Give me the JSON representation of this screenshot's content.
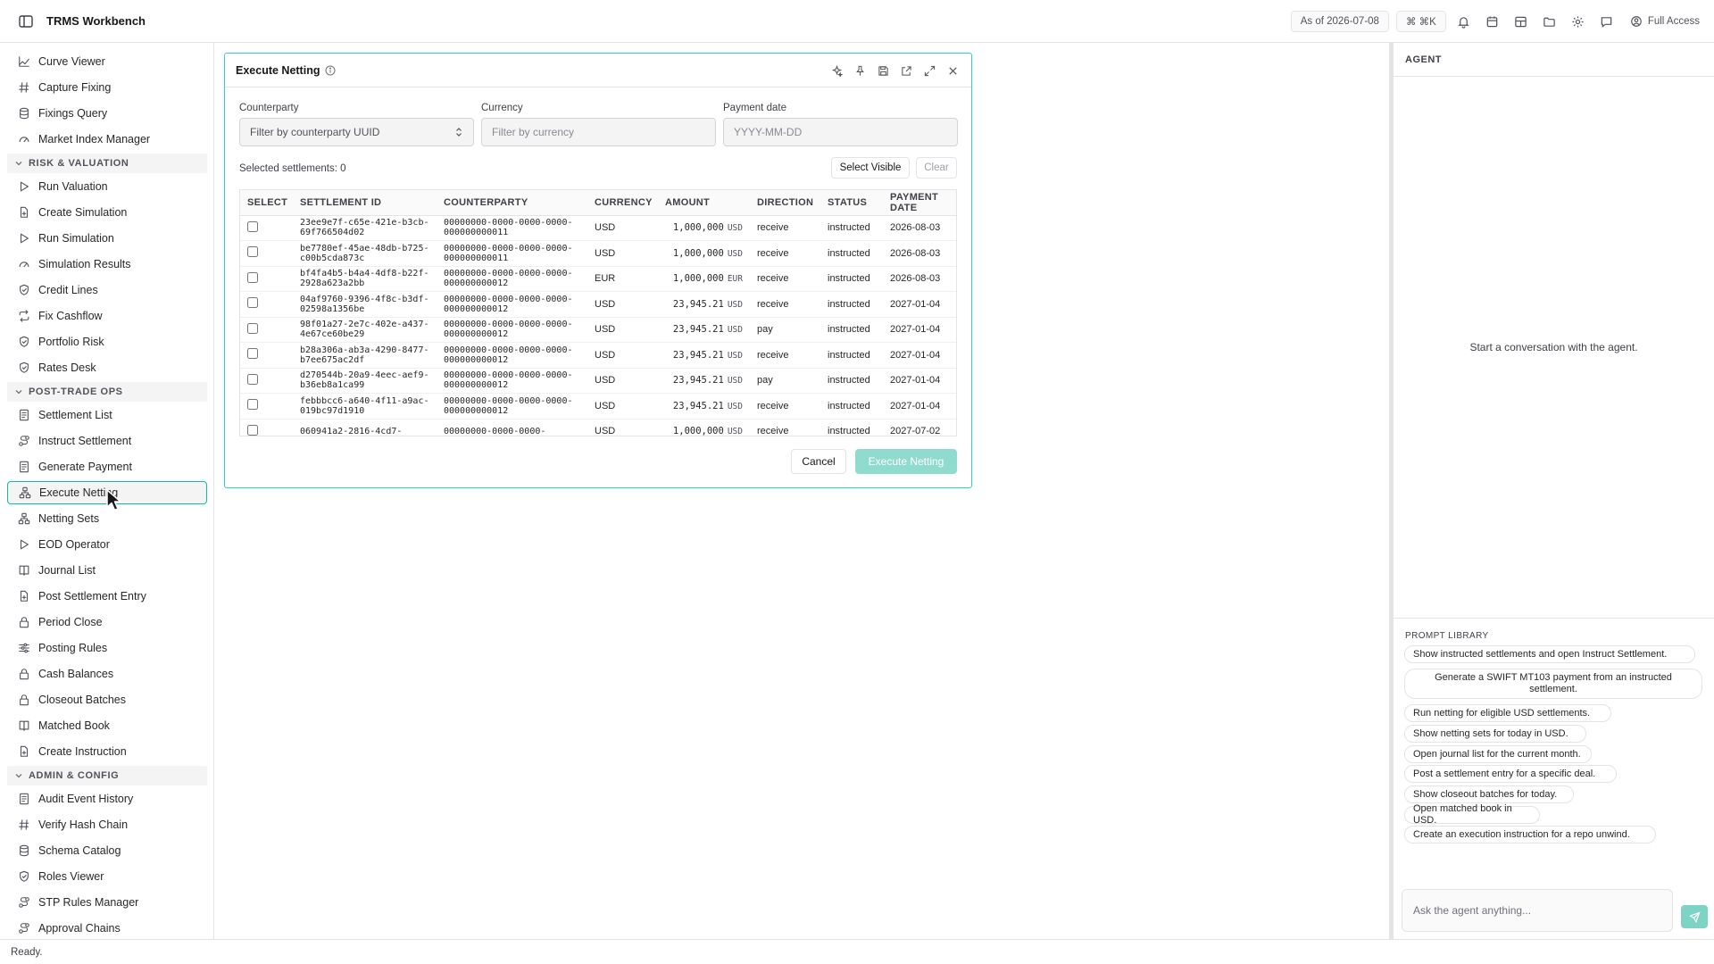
{
  "app": {
    "title": "TRMS Workbench",
    "as_of": "As of 2026-07-08",
    "shortcut": "⌘ ⌘K",
    "access": "Full Access"
  },
  "sidebar": {
    "groups": [
      {
        "heading": null,
        "items": [
          {
            "label": "Curve Viewer",
            "icon": "line-chart-icon"
          },
          {
            "label": "Capture Fixing",
            "icon": "hash-icon"
          },
          {
            "label": "Fixings Query",
            "icon": "database-icon"
          },
          {
            "label": "Market Index Manager",
            "icon": "gauge-icon"
          }
        ]
      },
      {
        "heading": "RISK & VALUATION",
        "items": [
          {
            "label": "Run Valuation",
            "icon": "play-icon"
          },
          {
            "label": "Create Simulation",
            "icon": "file-plus-icon"
          },
          {
            "label": "Run Simulation",
            "icon": "play-icon"
          },
          {
            "label": "Simulation Results",
            "icon": "gauge-icon"
          },
          {
            "label": "Credit Lines",
            "icon": "shield-icon"
          },
          {
            "label": "Fix Cashflow",
            "icon": "repeat-icon"
          },
          {
            "label": "Portfolio Risk",
            "icon": "shield-icon"
          },
          {
            "label": "Rates Desk",
            "icon": "shield-icon"
          }
        ]
      },
      {
        "heading": "POST-TRADE OPS",
        "items": [
          {
            "label": "Settlement List",
            "icon": "list-doc-icon"
          },
          {
            "label": "Instruct Settlement",
            "icon": "route-icon"
          },
          {
            "label": "Generate Payment",
            "icon": "list-doc-icon"
          },
          {
            "label": "Execute Netting",
            "icon": "network-icon",
            "active": true
          },
          {
            "label": "Netting Sets",
            "icon": "network-icon"
          },
          {
            "label": "EOD Operator",
            "icon": "play-icon"
          },
          {
            "label": "Journal List",
            "icon": "book-icon"
          },
          {
            "label": "Post Settlement Entry",
            "icon": "file-plus-icon"
          },
          {
            "label": "Period Close",
            "icon": "lock-icon"
          },
          {
            "label": "Posting Rules",
            "icon": "sliders-icon"
          },
          {
            "label": "Cash Balances",
            "icon": "lock-icon"
          },
          {
            "label": "Closeout Batches",
            "icon": "lock-icon"
          },
          {
            "label": "Matched Book",
            "icon": "book-icon"
          },
          {
            "label": "Create Instruction",
            "icon": "file-plus-icon"
          }
        ]
      },
      {
        "heading": "ADMIN & CONFIG",
        "items": [
          {
            "label": "Audit Event History",
            "icon": "list-doc-icon"
          },
          {
            "label": "Verify Hash Chain",
            "icon": "hash-icon"
          },
          {
            "label": "Schema Catalog",
            "icon": "database-icon"
          },
          {
            "label": "Roles Viewer",
            "icon": "shield-icon"
          },
          {
            "label": "STP Rules Manager",
            "icon": "route-icon"
          },
          {
            "label": "Approval Chains",
            "icon": "route-icon"
          }
        ]
      }
    ]
  },
  "modal": {
    "title": "Execute Netting",
    "filters": {
      "counterparty_label": "Counterparty",
      "counterparty_placeholder": "Filter by counterparty UUID",
      "currency_label": "Currency",
      "currency_placeholder": "Filter by currency",
      "payment_date_label": "Payment date",
      "payment_date_placeholder": "YYYY-MM-DD"
    },
    "selected_text": "Selected settlements: 0",
    "select_visible": "Select Visible",
    "clear": "Clear",
    "table": {
      "headers": [
        "SELECT",
        "SETTLEMENT ID",
        "COUNTERPARTY",
        "CURRENCY",
        "AMOUNT",
        "DIRECTION",
        "STATUS",
        "PAYMENT DATE"
      ],
      "rows": [
        {
          "id": "23ee9e7f-c65e-421e-b3cb-69f766504d02",
          "cp": "00000000-0000-0000-0000-000000000011",
          "ccy": "USD",
          "amount": "1,000,000",
          "amt_ccy": "USD",
          "direction": "receive",
          "status": "instructed",
          "date": "2026-08-03"
        },
        {
          "id": "be7780ef-45ae-48db-b725-c00b5cda873c",
          "cp": "00000000-0000-0000-0000-000000000011",
          "ccy": "USD",
          "amount": "1,000,000",
          "amt_ccy": "USD",
          "direction": "receive",
          "status": "instructed",
          "date": "2026-08-03"
        },
        {
          "id": "bf4fa4b5-b4a4-4df8-b22f-2928a623a2bb",
          "cp": "00000000-0000-0000-0000-000000000012",
          "ccy": "EUR",
          "amount": "1,000,000",
          "amt_ccy": "EUR",
          "direction": "receive",
          "status": "instructed",
          "date": "2026-08-03"
        },
        {
          "id": "04af9760-9396-4f8c-b3df-02598a1356be",
          "cp": "00000000-0000-0000-0000-000000000012",
          "ccy": "USD",
          "amount": "23,945.21",
          "amt_ccy": "USD",
          "direction": "receive",
          "status": "instructed",
          "date": "2027-01-04"
        },
        {
          "id": "98f01a27-2e7c-402e-a437-4e67ce60be29",
          "cp": "00000000-0000-0000-0000-000000000012",
          "ccy": "USD",
          "amount": "23,945.21",
          "amt_ccy": "USD",
          "direction": "pay",
          "status": "instructed",
          "date": "2027-01-04"
        },
        {
          "id": "b28a306a-ab3a-4290-8477-b7ee675ac2df",
          "cp": "00000000-0000-0000-0000-000000000012",
          "ccy": "USD",
          "amount": "23,945.21",
          "amt_ccy": "USD",
          "direction": "receive",
          "status": "instructed",
          "date": "2027-01-04"
        },
        {
          "id": "d270544b-20a9-4eec-aef9-b36eb8a1ca99",
          "cp": "00000000-0000-0000-0000-000000000012",
          "ccy": "USD",
          "amount": "23,945.21",
          "amt_ccy": "USD",
          "direction": "pay",
          "status": "instructed",
          "date": "2027-01-04"
        },
        {
          "id": "febbbcc6-a640-4f11-a9ac-019bc97d1910",
          "cp": "00000000-0000-0000-0000-000000000012",
          "ccy": "USD",
          "amount": "23,945.21",
          "amt_ccy": "USD",
          "direction": "receive",
          "status": "instructed",
          "date": "2027-01-04"
        },
        {
          "id": "060941a2-2816-4cd7-",
          "cp": "00000000-0000-0000-",
          "ccy": "USD",
          "amount": "1,000,000",
          "amt_ccy": "USD",
          "direction": "receive",
          "status": "instructed",
          "date": "2027-07-02"
        }
      ]
    },
    "cancel": "Cancel",
    "execute": "Execute Netting"
  },
  "agent": {
    "title": "AGENT",
    "empty": "Start a conversation with the agent.",
    "prompt_library": "PROMPT LIBRARY",
    "prompts": [
      "Show instructed settlements and open Instruct Settlement.",
      "Generate a SWIFT MT103 payment from an instructed settlement.",
      "Run netting for eligible USD settlements.",
      "Show netting sets for today in USD.",
      "Open journal list for the current month.",
      "Post a settlement entry for a specific deal.",
      "Show closeout batches for today.",
      "Open matched book in USD.",
      "Create an execution instruction for a repo unwind."
    ],
    "ask_placeholder": "Ask the agent anything..."
  },
  "status": "Ready.",
  "colors": {
    "accent": "#14b8a6",
    "accent_soft": "#8fdccf"
  }
}
